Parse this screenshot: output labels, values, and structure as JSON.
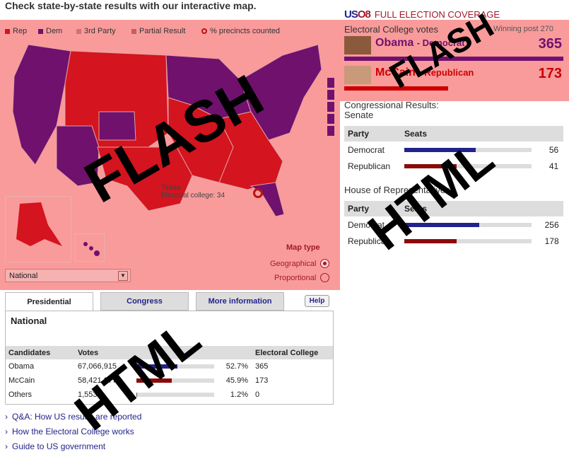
{
  "headline": "Check state-by-state results with our interactive map.",
  "legend": [
    {
      "label": "Rep",
      "color": "#d4141e"
    },
    {
      "label": "Dem",
      "color": "#70116e"
    },
    {
      "label": "3rd Party",
      "color": "#d07272"
    },
    {
      "label": "Partial Result",
      "color": "#c06060"
    },
    {
      "label": "% precincts counted",
      "icon": "ring-icon"
    }
  ],
  "brand": {
    "logo_a": "US",
    "logo_b": "O8",
    "title": "FULL ELECTION COVERAGE"
  },
  "electoral": {
    "heading": "Electoral College votes",
    "winning_post": "Winning post 270",
    "candidates": [
      {
        "name": "Obama",
        "party": "- Democrat",
        "votes": "365",
        "color": "#70116e",
        "share": 1.0
      },
      {
        "name": "McCain",
        "party": "- Republican",
        "votes": "173",
        "color": "#c00",
        "share": 0.474
      }
    ]
  },
  "congress": {
    "title_line1": "Congressional Results:",
    "senate_title": "Senate",
    "house_title": "House of Representatives",
    "col_party": "Party",
    "col_seats": "Seats",
    "senate": [
      {
        "party": "Democrat",
        "seats": "56",
        "share": 0.56,
        "color": "#22238a"
      },
      {
        "party": "Republican",
        "seats": "41",
        "share": 0.41,
        "color": "#8b0a0a"
      }
    ],
    "house": [
      {
        "party": "Democrat",
        "seats": "256",
        "share": 0.59,
        "color": "#22238a"
      },
      {
        "party": "Republican",
        "seats": "178",
        "share": 0.41,
        "color": "#8b0a0a"
      }
    ]
  },
  "map": {
    "tooltip_state": "Texas",
    "tooltip_ec": "Electoral college: 34",
    "dropdown_value": "National",
    "map_type_label": "Map type",
    "options": [
      "Geographical",
      "Proportional"
    ],
    "selected_option": "Geographical"
  },
  "tabs": [
    "Presidential",
    "Congress",
    "More information"
  ],
  "help_label": "Help",
  "results": {
    "title": "National",
    "columns": [
      "Candidates",
      "Votes",
      "",
      "Electoral College"
    ],
    "rows": [
      {
        "name": "Obama",
        "votes": "67,066,915",
        "pct": "52.7%",
        "ec": "365",
        "share": 0.527,
        "color": "#22238a"
      },
      {
        "name": "McCain",
        "votes": "58,421,377",
        "pct": "45.9%",
        "ec": "173",
        "share": 0.459,
        "color": "#8b0a0a"
      },
      {
        "name": "Others",
        "votes": "1,553,9",
        "pct": "1.2%",
        "ec": "0",
        "share": 0.012,
        "color": "#555"
      }
    ]
  },
  "links": [
    "Q&A: How US results are reported",
    "How the Electoral College works",
    "Guide to US government"
  ],
  "watermarks": {
    "flash": "FLASH",
    "html": "HTML"
  }
}
